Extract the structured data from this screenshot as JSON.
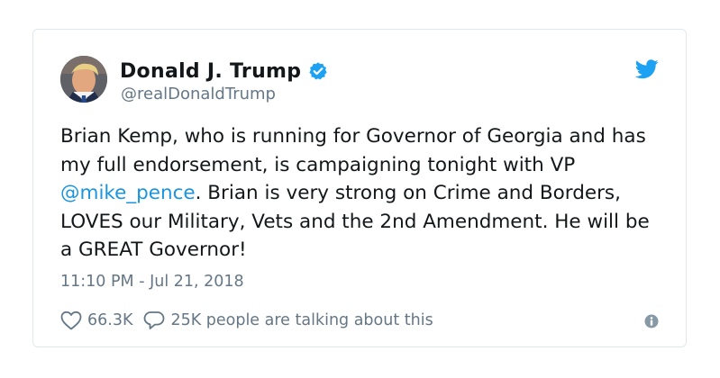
{
  "author": {
    "display_name": "Donald J. Trump",
    "handle": "@realDonaldTrump",
    "verified": true
  },
  "tweet": {
    "text_before_mention": "Brian Kemp, who is running for Governor of Georgia and has my full endorsement, is campaigning tonight with VP ",
    "mention": "@mike_pence",
    "text_after_mention": ". Brian is very strong on Crime and Borders, LOVES our Military, Vets and the 2nd Amendment. He will be a GREAT Governor!",
    "timestamp": "11:10 PM - Jul 21, 2018"
  },
  "actions": {
    "likes": "66.3K",
    "replies_text": "25K people are talking about this"
  },
  "icons": {
    "verified": "verified-badge-icon",
    "logo": "twitter-bird-icon",
    "like": "heart-icon",
    "reply": "speech-bubble-icon",
    "info": "info-icon"
  },
  "colors": {
    "brand": "#1da1f2",
    "link": "#1b95e0",
    "text": "#14171a",
    "secondary": "#657786",
    "border": "#e1e8ed"
  }
}
